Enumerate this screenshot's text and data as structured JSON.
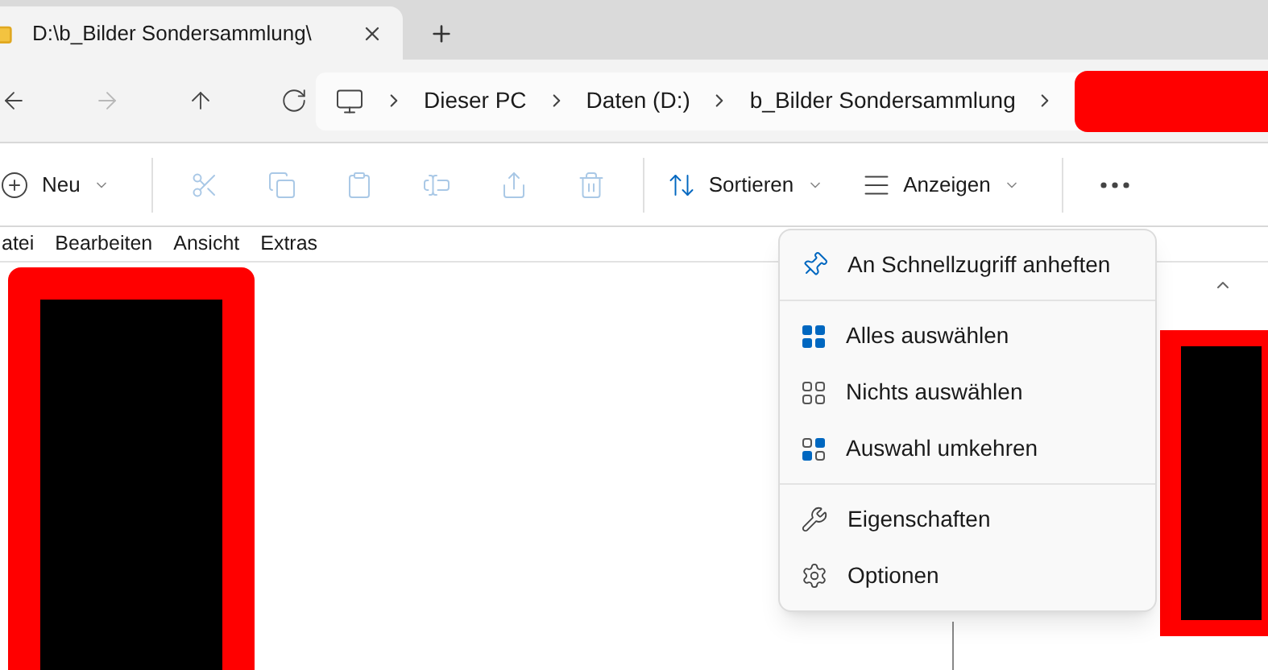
{
  "tab": {
    "title": "D:\\b_Bilder Sondersammlung\\"
  },
  "nav": [
    {
      "kind": "back",
      "disabled": false
    },
    {
      "kind": "forward",
      "disabled": true
    },
    {
      "kind": "up",
      "disabled": false
    },
    {
      "kind": "refresh",
      "disabled": false
    }
  ],
  "breadcrumb": [
    "Dieser PC",
    "Daten (D:)",
    "b_Bilder Sondersammlung"
  ],
  "toolbar": [
    {
      "kind": "new",
      "label": "Neu",
      "disabled": false
    },
    {
      "kind": "cut",
      "disabled": true
    },
    {
      "kind": "copy",
      "disabled": true
    },
    {
      "kind": "paste",
      "disabled": true
    },
    {
      "kind": "rename",
      "disabled": true
    },
    {
      "kind": "share",
      "disabled": true
    },
    {
      "kind": "delete",
      "disabled": true
    },
    {
      "kind": "sort",
      "label": "Sortieren",
      "disabled": false
    },
    {
      "kind": "view",
      "label": "Anzeigen",
      "disabled": false
    },
    {
      "kind": "more",
      "disabled": false
    }
  ],
  "menu_bar": [
    "atei",
    "Bearbeiten",
    "Ansicht",
    "Extras"
  ],
  "context_menu": {
    "groups": [
      {
        "items": [
          {
            "kind": "pin",
            "label": "An Schnellzugriff anheften"
          }
        ]
      },
      {
        "items": [
          {
            "kind": "select_all",
            "label": "Alles auswählen"
          },
          {
            "kind": "select_none",
            "label": "Nichts auswählen"
          },
          {
            "kind": "invert",
            "label": "Auswahl umkehren"
          }
        ]
      },
      {
        "items": [
          {
            "kind": "properties",
            "label": "Eigenschaften"
          },
          {
            "kind": "options",
            "label": "Optionen"
          }
        ]
      }
    ]
  }
}
